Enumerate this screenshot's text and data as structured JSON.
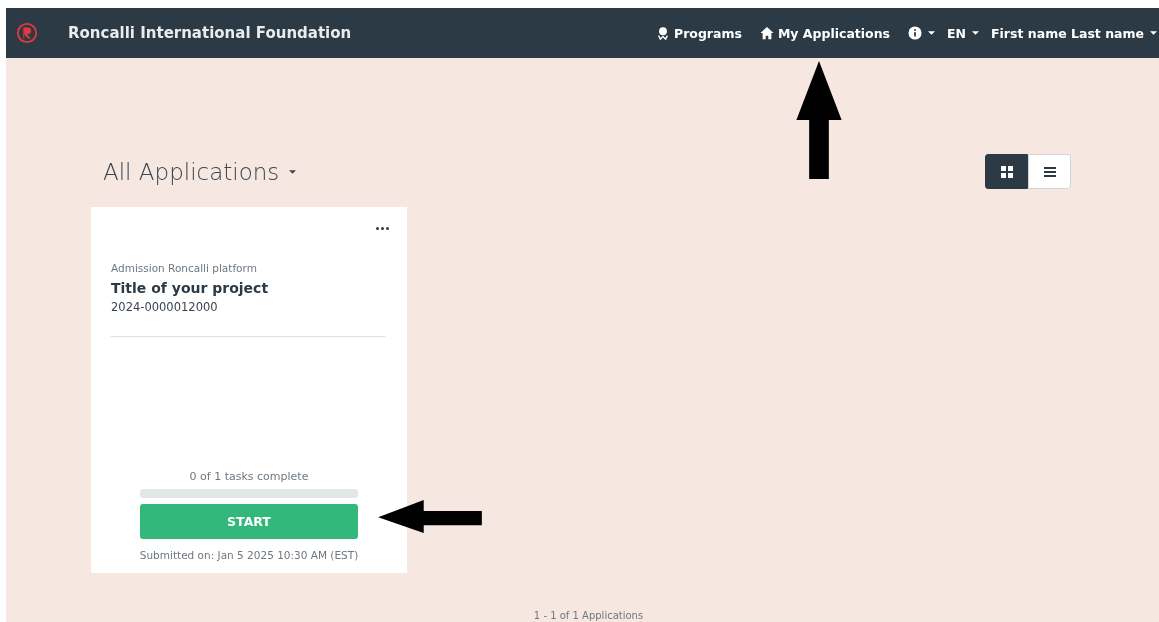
{
  "navbar": {
    "brand": "Roncalli International Foundation",
    "links": [
      {
        "kind": "programs",
        "label": "Programs"
      },
      {
        "kind": "home",
        "label": "My Applications"
      }
    ],
    "info_menu": {
      "kind": "info"
    },
    "language": "EN",
    "user": "First name Last name"
  },
  "heading": "All Applications",
  "view_toggle": [
    {
      "kind": "grid",
      "selected": true
    },
    {
      "kind": "list",
      "selected": false
    }
  ],
  "applications": [
    {
      "program": "Admission Roncalli platform",
      "title": "Title of your project",
      "number": "2024-0000012000",
      "tasks": "0 of 1 tasks complete",
      "level": 0,
      "button": "START",
      "submitted": "Submitted on: Jan 5 2025 10:30 AM (EST)"
    }
  ],
  "pagination": "1 - 1 of 1 Applications",
  "annotations": [
    {
      "kind": "up_arrow"
    },
    {
      "kind": "left_arrow"
    }
  ]
}
